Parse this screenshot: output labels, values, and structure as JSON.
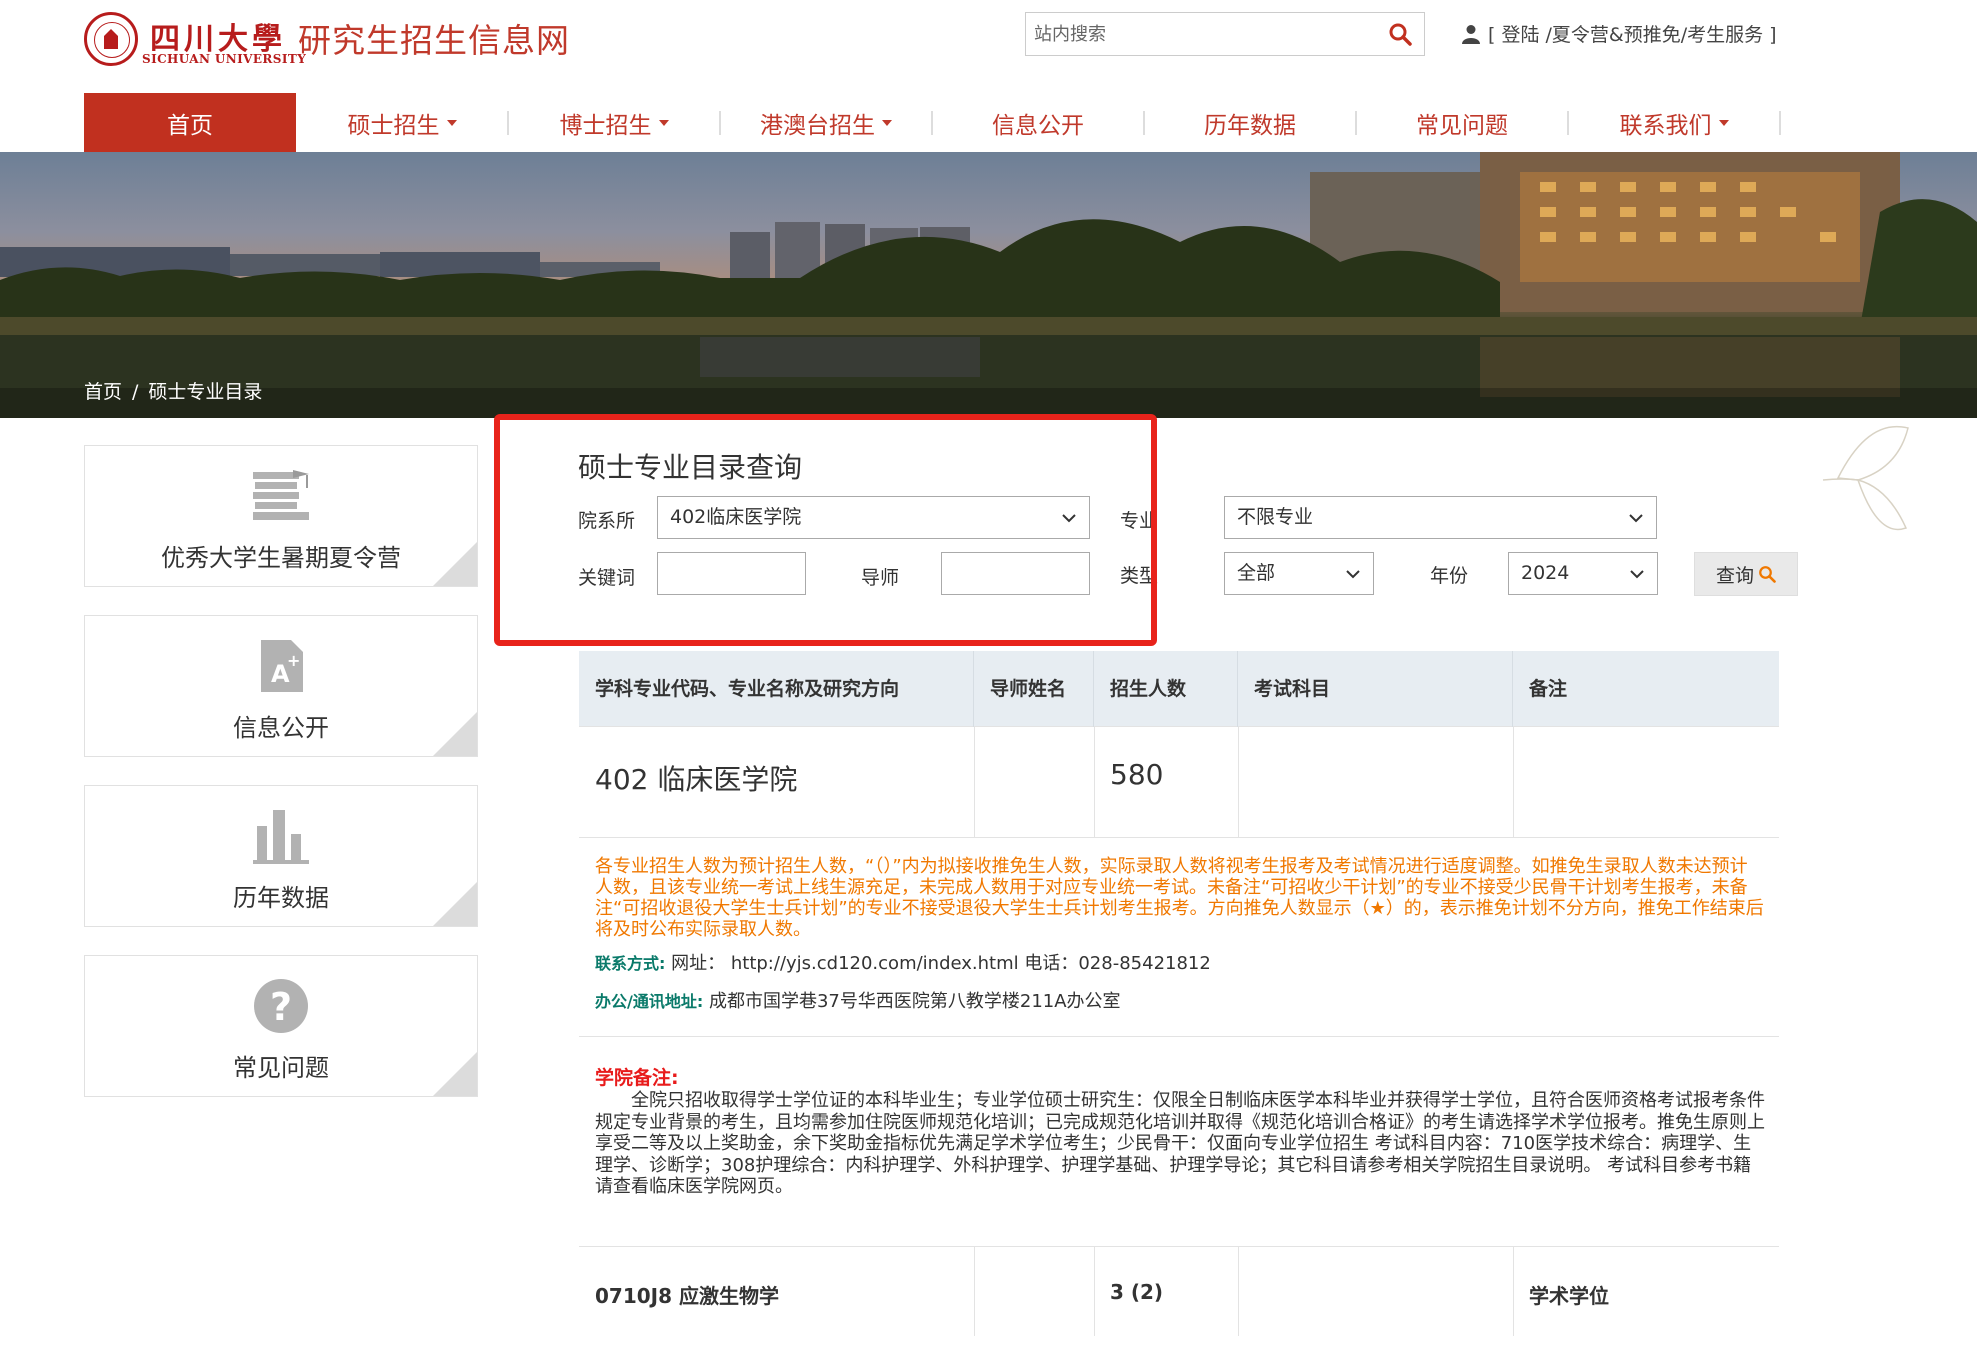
{
  "header": {
    "logo_cn": "四川大學",
    "logo_en": "SICHUAN UNIVERSITY",
    "site_title": "研究生招生信息网",
    "search_placeholder": "站内搜索",
    "user_link": "[ 登陆 /夏令营&预推免/考生服务 ]"
  },
  "nav": {
    "items": [
      {
        "label": "首页",
        "active": true,
        "dropdown": false
      },
      {
        "label": "硕士招生",
        "dropdown": true
      },
      {
        "label": "博士招生",
        "dropdown": true
      },
      {
        "label": "港澳台招生",
        "dropdown": true
      },
      {
        "label": "信息公开",
        "dropdown": false
      },
      {
        "label": "历年数据",
        "dropdown": false
      },
      {
        "label": "常见问题",
        "dropdown": false
      },
      {
        "label": "联系我们",
        "dropdown": true
      }
    ]
  },
  "breadcrumb": {
    "home": "首页",
    "separator": "/",
    "current": "硕士专业目录"
  },
  "sidebar": {
    "items": [
      {
        "label": "优秀大学生暑期夏令营",
        "icon": "books-icon"
      },
      {
        "label": "信息公开",
        "icon": "document-plus-icon"
      },
      {
        "label": "历年数据",
        "icon": "bar-chart-icon"
      },
      {
        "label": "常见问题",
        "icon": "question-icon"
      }
    ]
  },
  "query": {
    "title": "硕士专业目录查询",
    "dept_label": "院系所",
    "dept_value": "402临床医学院",
    "major_label": "专业",
    "major_value": "不限专业",
    "keyword_label": "关键词",
    "keyword_value": "",
    "advisor_label": "导师",
    "advisor_value": "",
    "type_label": "类型",
    "type_value": "全部",
    "year_label": "年份",
    "year_value": "2024",
    "query_button": "查询"
  },
  "table": {
    "headers": [
      "学科专业代码、专业名称及研究方向",
      "导师姓名",
      "招生人数",
      "考试科目",
      "备注"
    ],
    "dept_row": {
      "name": "402 临床医学院",
      "count": "580"
    },
    "notice": "各专业招生人数为预计招生人数，“（）”内为拟接收推免生人数，实际录取人数将视考生报考及考试情况进行适度调整。如推免生录取人数未达预计人数，且该专业统一考试上线生源充足，未完成人数用于对应专业统一考试。未备注“可招收少干计划”的专业不接受少民骨干计划考生报考，未备注“可招收退役大学生士兵计划”的专业不接受退役大学生士兵计划考生报考。方向推免人数显示（★）的，表示推免计划不分方向，推免工作结束后将及时公布实际录取人数。",
    "contact_label": "联系方式:",
    "contact_text": "网址： http://yjs.cd120.com/index.html 电话：028-85421812",
    "address_label": "办公/通讯地址:",
    "address_text": "成都市国学巷37号华西医院第八教学楼211A办公室",
    "remark_title": "学院备注:",
    "remark": "全院只招收取得学士学位证的本科毕业生；专业学位硕士研究生：仅限全日制临床医学本科毕业并获得学士学位，且符合医师资格考试报考条件规定专业背景的考生，且均需参加住院医师规范化培训；已完成规范化培训并取得《规范化培训合格证》的考生请选择学术学位报考。推免生原则上享受二等及以上奖助金，余下奖助金指标优先满足学术学位考生；少民骨干：仅面向专业学位招生 考试科目内容：710医学技术综合：病理学、生理学、诊断学；308护理综合：内科护理学、外科护理学、护理学基础、护理学导论；其它科目请参考相关学院招生目录说明。 考试科目参考书籍请查看临床医学院网页。",
    "major_row": {
      "code_name": "0710J8 应激生物学",
      "count": "3 (2)",
      "note": "学术学位"
    }
  },
  "colors": {
    "brand_red": "#c1301f",
    "nav_text": "#c0392b",
    "notice_orange": "#f07800",
    "remark_red": "#e81b1b",
    "highlight": "#e8231b"
  }
}
